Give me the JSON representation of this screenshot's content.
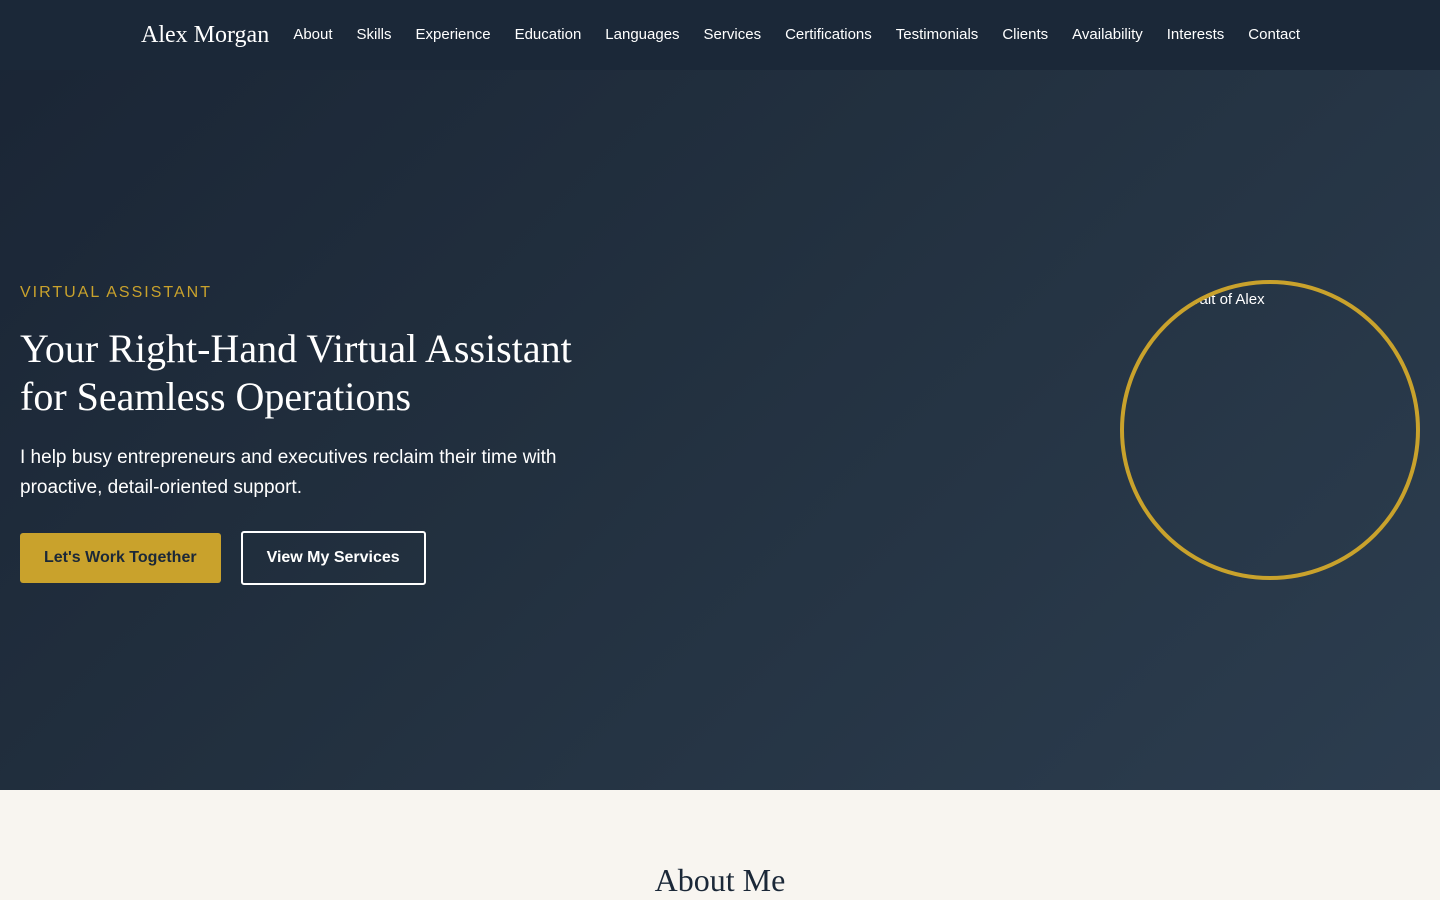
{
  "header": {
    "brand": "Alex Morgan",
    "nav": [
      "About",
      "Skills",
      "Experience",
      "Education",
      "Languages",
      "Services",
      "Certifications",
      "Testimonials",
      "Clients",
      "Availability",
      "Interests",
      "Contact"
    ]
  },
  "hero": {
    "eyebrow": "VIRTUAL ASSISTANT",
    "title_line1": "Your Right-Hand Virtual Assistant",
    "title_line2": "for Seamless Operations",
    "subtitle": "I help busy entrepreneurs and executives reclaim their time with proactive, detail-oriented support.",
    "primary_cta": "Let's Work Together",
    "secondary_cta": "View My Services",
    "portrait_alt": "Professional portrait of Alex"
  },
  "about": {
    "title": "About Me"
  },
  "colors": {
    "navy": "#1b2838",
    "gold": "#c9a22c",
    "cream": "#f8f5f0"
  }
}
